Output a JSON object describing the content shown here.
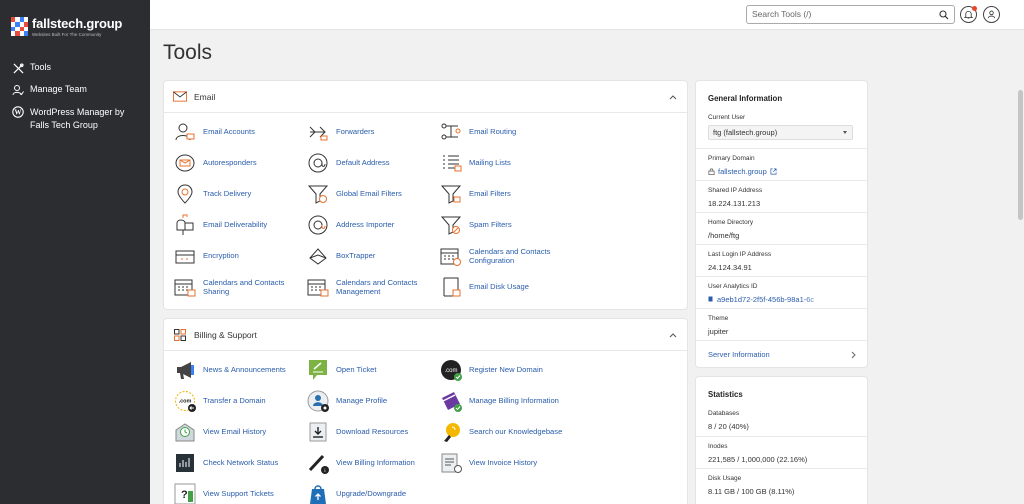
{
  "brand": {
    "name": "fallstech.group",
    "tagline": "Websites Built For The Community"
  },
  "sidebar": {
    "items": [
      {
        "label": "Tools",
        "icon": "wrench-cross-icon"
      },
      {
        "label": "Manage Team",
        "icon": "team-icon"
      },
      {
        "label": "WordPress Manager by Falls Tech Group",
        "icon": "wordpress-icon"
      }
    ]
  },
  "topbar": {
    "search_placeholder": "Search Tools (/)"
  },
  "page": {
    "title": "Tools"
  },
  "email": {
    "title": "Email",
    "tools": [
      {
        "label": "Email Accounts",
        "icon": "email-accounts-icon"
      },
      {
        "label": "Forwarders",
        "icon": "forwarders-icon"
      },
      {
        "label": "Email Routing",
        "icon": "email-routing-icon"
      },
      {
        "label": "Autoresponders",
        "icon": "autoresponders-icon"
      },
      {
        "label": "Default Address",
        "icon": "default-address-icon"
      },
      {
        "label": "Mailing Lists",
        "icon": "mailing-lists-icon"
      },
      {
        "label": "Track Delivery",
        "icon": "track-delivery-icon"
      },
      {
        "label": "Global Email Filters",
        "icon": "global-filters-icon"
      },
      {
        "label": "Email Filters",
        "icon": "email-filters-icon"
      },
      {
        "label": "Email Deliverability",
        "icon": "mailbox-icon"
      },
      {
        "label": "Address Importer",
        "icon": "address-importer-icon"
      },
      {
        "label": "Spam Filters",
        "icon": "spam-filters-icon"
      },
      {
        "label": "Encryption",
        "icon": "encryption-icon"
      },
      {
        "label": "BoxTrapper",
        "icon": "boxtrapper-icon"
      },
      {
        "label": "Calendars and Contacts Configuration",
        "icon": "calendar-config-icon"
      },
      {
        "label": "Calendars and Contacts Sharing",
        "icon": "calendar-sharing-icon"
      },
      {
        "label": "Calendars and Contacts Management",
        "icon": "calendar-management-icon"
      },
      {
        "label": "Email Disk Usage",
        "icon": "disk-usage-icon"
      }
    ]
  },
  "billing": {
    "title": "Billing & Support",
    "tools": [
      {
        "label": "News & Announcements",
        "icon": "megaphone-icon"
      },
      {
        "label": "Open Ticket",
        "icon": "open-ticket-icon"
      },
      {
        "label": "Register New Domain",
        "icon": "register-domain-icon"
      },
      {
        "label": "Transfer a Domain",
        "icon": "transfer-domain-icon"
      },
      {
        "label": "Manage Profile",
        "icon": "manage-profile-icon"
      },
      {
        "label": "Manage Billing Information",
        "icon": "billing-card-icon"
      },
      {
        "label": "View Email History",
        "icon": "email-history-icon"
      },
      {
        "label": "Download Resources",
        "icon": "download-icon"
      },
      {
        "label": "Search our Knowledgebase",
        "icon": "lightbulb-icon"
      },
      {
        "label": "Check Network Status",
        "icon": "network-status-icon"
      },
      {
        "label": "View Billing Information",
        "icon": "billing-info-icon"
      },
      {
        "label": "View Invoice History",
        "icon": "invoice-history-icon"
      },
      {
        "label": "View Support Tickets",
        "icon": "support-tickets-icon"
      },
      {
        "label": "Upgrade/Downgrade",
        "icon": "upgrade-icon"
      }
    ]
  },
  "general": {
    "title": "General Information",
    "current_user_label": "Current User",
    "current_user": "ftg (fallstech.group)",
    "primary_domain_label": "Primary Domain",
    "primary_domain": "fallstech.group",
    "shared_ip_label": "Shared IP Address",
    "shared_ip": "18.224.131.213",
    "home_dir_label": "Home Directory",
    "home_dir": "/home/ftg",
    "last_login_label": "Last Login IP Address",
    "last_login": "24.124.34.91",
    "analytics_label": "User Analytics ID",
    "analytics_id": "a9eb1d72-2f5f-456b-98a1-6c",
    "theme_label": "Theme",
    "theme": "jupiter",
    "server_info": "Server Information"
  },
  "statistics": {
    "title": "Statistics",
    "databases_label": "Databases",
    "databases": "8 / 20  (40%)",
    "inodes_label": "Inodes",
    "inodes": "221,585 / 1,000,000  (22.16%)",
    "disk_label": "Disk Usage",
    "disk": "8.11 GB / 100 GB  (8.11%)"
  },
  "colors": {
    "sidebar": "#2b2d31",
    "link": "#2a5dab",
    "accent_orange": "#e8712c"
  }
}
